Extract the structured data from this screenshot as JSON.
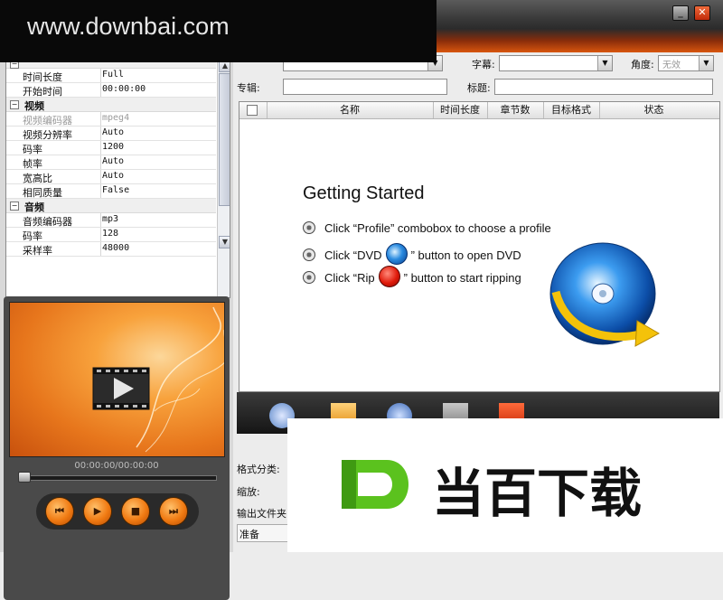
{
  "watermark": {
    "text": "www.downbai.com"
  },
  "window": {
    "minimize_glyph": "_",
    "close_glyph": "✕"
  },
  "properties": {
    "rows": [
      {
        "key": "时间长度",
        "value": "Full"
      },
      {
        "key": "开始时间",
        "value": "00:00:00"
      }
    ],
    "section_video": "视频",
    "video_rows": [
      {
        "key": "视频编码器",
        "value": "mpeg4",
        "disabled": true
      },
      {
        "key": "视频分辨率",
        "value": "Auto"
      },
      {
        "key": "码率",
        "value": "1200"
      },
      {
        "key": "帧率",
        "value": "Auto"
      },
      {
        "key": "宽高比",
        "value": "Auto"
      },
      {
        "key": "相同质量",
        "value": "False"
      }
    ],
    "section_audio": "音频",
    "audio_rows": [
      {
        "key": "音频编码器",
        "value": "mp3"
      },
      {
        "key": "码率",
        "value": "128"
      },
      {
        "key": "采样率",
        "value": "48000"
      }
    ]
  },
  "player": {
    "timecode": "00:00:00/00:00:00",
    "buttons": [
      "⏮",
      "▶",
      "■",
      "⏭"
    ]
  },
  "form": {
    "subtitle_label": "字幕:",
    "angle_label": "角度:",
    "angle_value": "无效",
    "album_label": "专辑:",
    "title_label": "标题:"
  },
  "list": {
    "columns": [
      "名称",
      "时间长度",
      "章节数",
      "目标格式",
      "状态"
    ]
  },
  "getting_started": {
    "title": "Getting Started",
    "line1": "Click “Profile” combobox to choose a profile",
    "line2_pre": "Click “DVD",
    "line2_post": "” button to open DVD",
    "line3_pre": "Click “Rip",
    "line3_post": "” button to start ripping"
  },
  "bottom": {
    "format_category_label": "格式分类:",
    "zoom_label": "缩放:",
    "output_folder_label": "输出文件夹",
    "status_text": "准备"
  },
  "ad": {
    "text": "当百下载"
  },
  "colors": {
    "accent": "#e8640e",
    "bar_dark": "#2b2b2b"
  }
}
